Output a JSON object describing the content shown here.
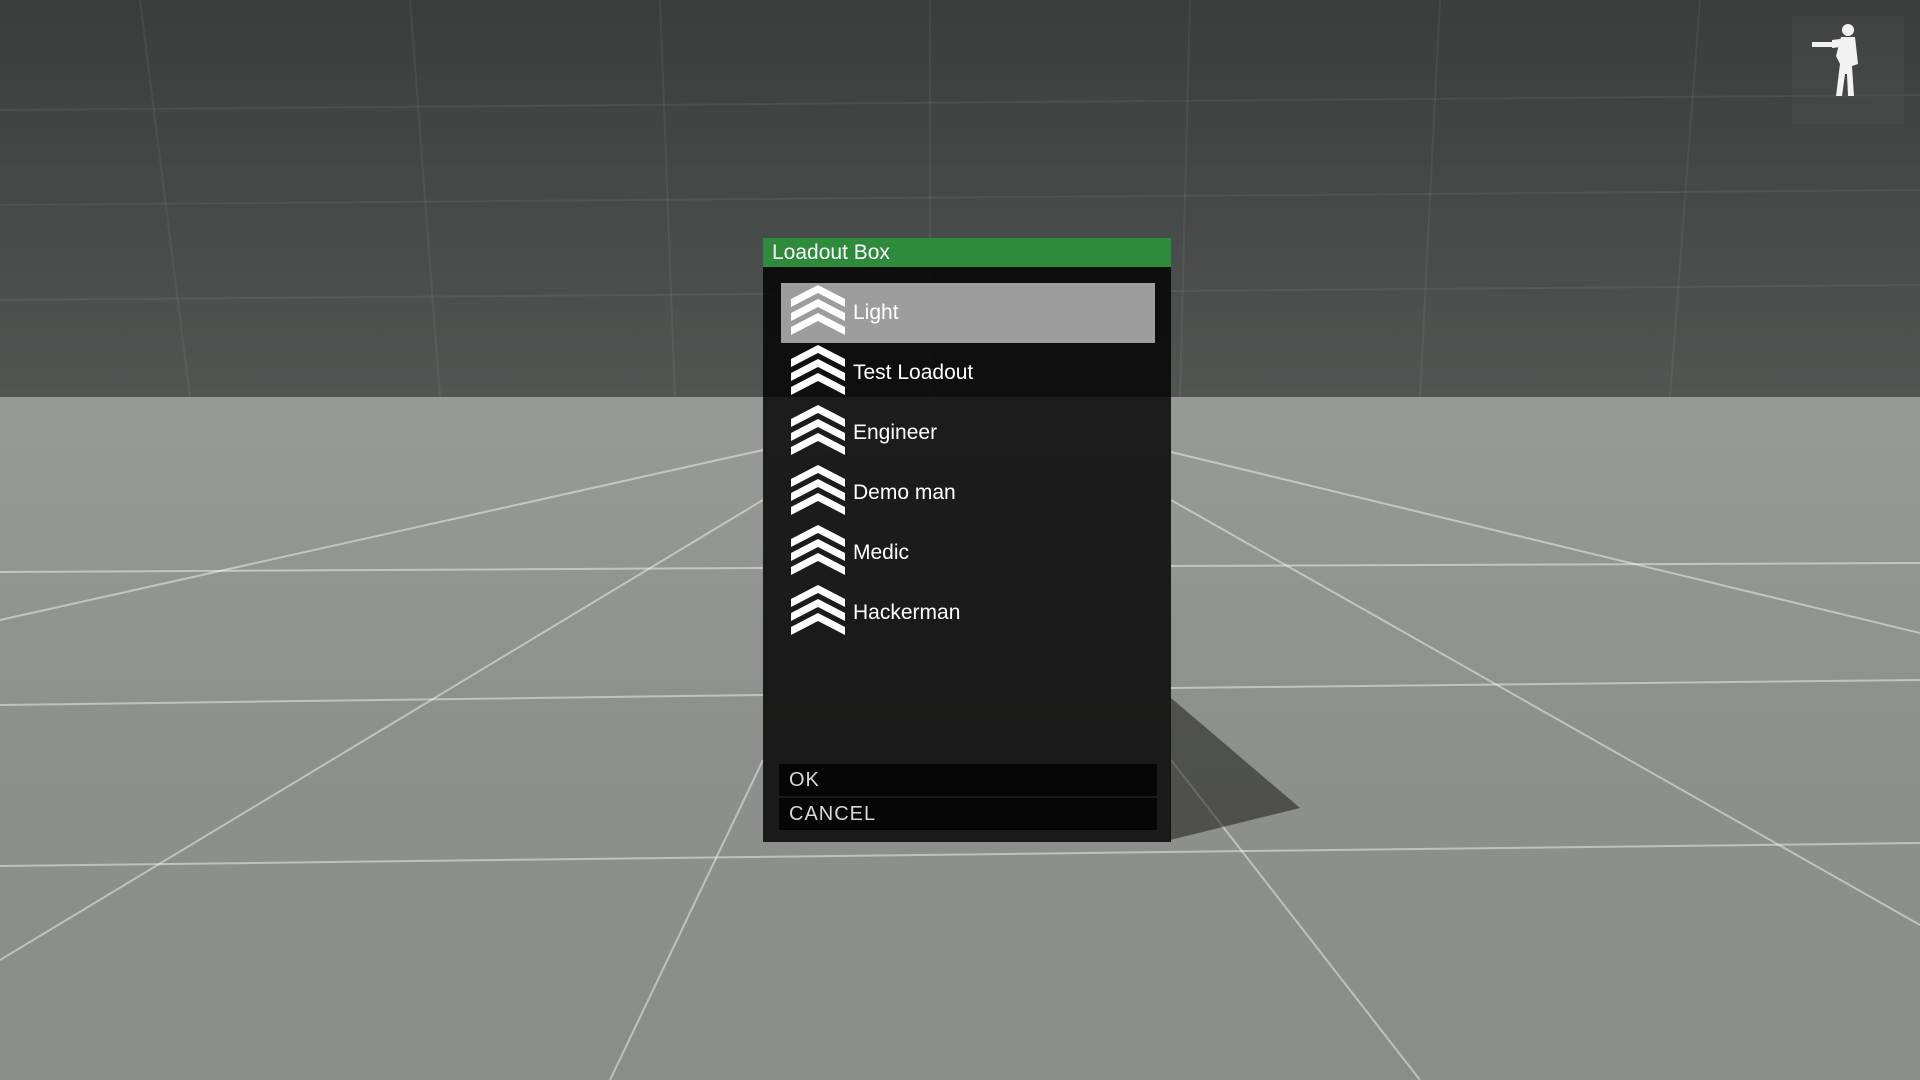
{
  "dialog": {
    "title": "Loadout Box",
    "accent_color": "#2e8b3c",
    "items": [
      {
        "label": "Light",
        "icon": "rank-chevrons-icon",
        "selected": true
      },
      {
        "label": "Test Loadout",
        "icon": "rank-chevrons-icon",
        "selected": false
      },
      {
        "label": "Engineer",
        "icon": "rank-chevrons-icon",
        "selected": false
      },
      {
        "label": "Demo man",
        "icon": "rank-chevrons-icon",
        "selected": false
      },
      {
        "label": "Medic",
        "icon": "rank-chevrons-icon",
        "selected": false
      },
      {
        "label": "Hackerman",
        "icon": "rank-chevrons-icon",
        "selected": false
      }
    ],
    "ok_label": "OK",
    "cancel_label": "CANCEL"
  },
  "hud": {
    "stance_icon": "soldier-standing-icon"
  }
}
